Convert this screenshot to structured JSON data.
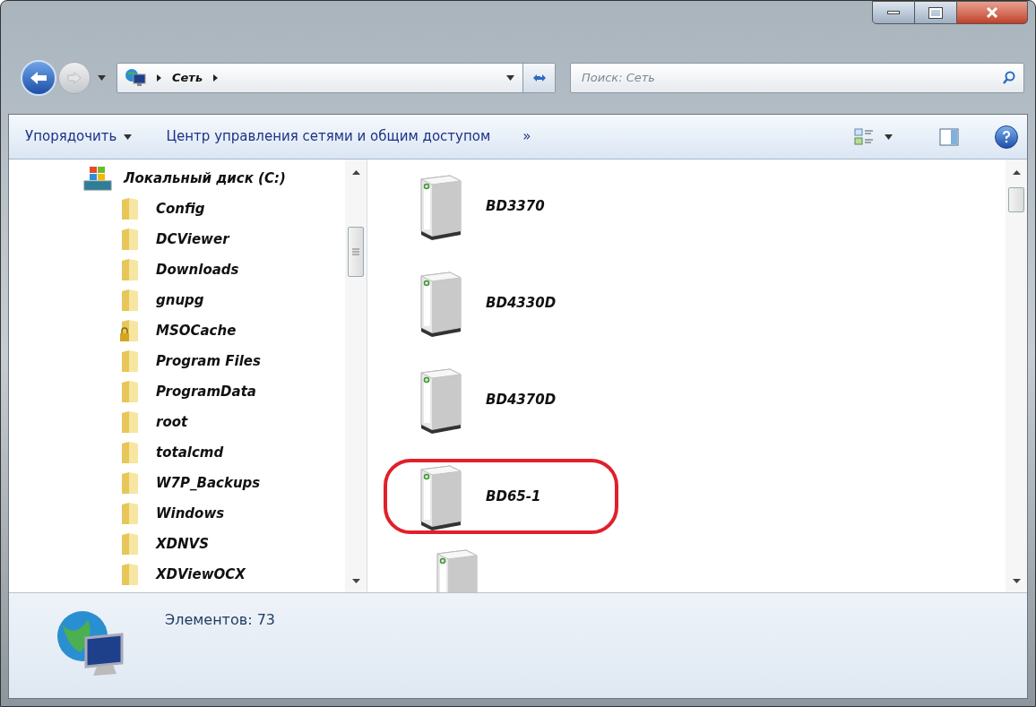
{
  "address_bar": {
    "path": [
      "Сеть"
    ]
  },
  "search": {
    "placeholder": "Поиск: Сеть"
  },
  "toolbar": {
    "organize": "Упорядочить",
    "network_center": "Центр управления сетями и общим доступом",
    "more": "»"
  },
  "tree": {
    "label": "Локальный диск (C:)",
    "expanded": true,
    "children": [
      {
        "label": "Config",
        "locked": false
      },
      {
        "label": "DCViewer",
        "locked": false
      },
      {
        "label": "Downloads",
        "locked": false
      },
      {
        "label": "gnupg",
        "locked": false
      },
      {
        "label": "MSOCache",
        "locked": true
      },
      {
        "label": "Program Files",
        "locked": false
      },
      {
        "label": "ProgramData",
        "locked": false
      },
      {
        "label": "root",
        "locked": false
      },
      {
        "label": "totalcmd",
        "locked": false
      },
      {
        "label": "W7P_Backups",
        "locked": false
      },
      {
        "label": "Windows",
        "locked": false
      },
      {
        "label": "XDNVS",
        "locked": false
      },
      {
        "label": "XDViewOCX",
        "locked": false
      }
    ]
  },
  "devices": [
    {
      "name": "BD3370",
      "highlighted": false
    },
    {
      "name": "BD4330D",
      "highlighted": false
    },
    {
      "name": "BD4370D",
      "highlighted": false
    },
    {
      "name": "BD65-1",
      "highlighted": true
    }
  ],
  "status_bar": {
    "count": "Элементов: 73"
  }
}
